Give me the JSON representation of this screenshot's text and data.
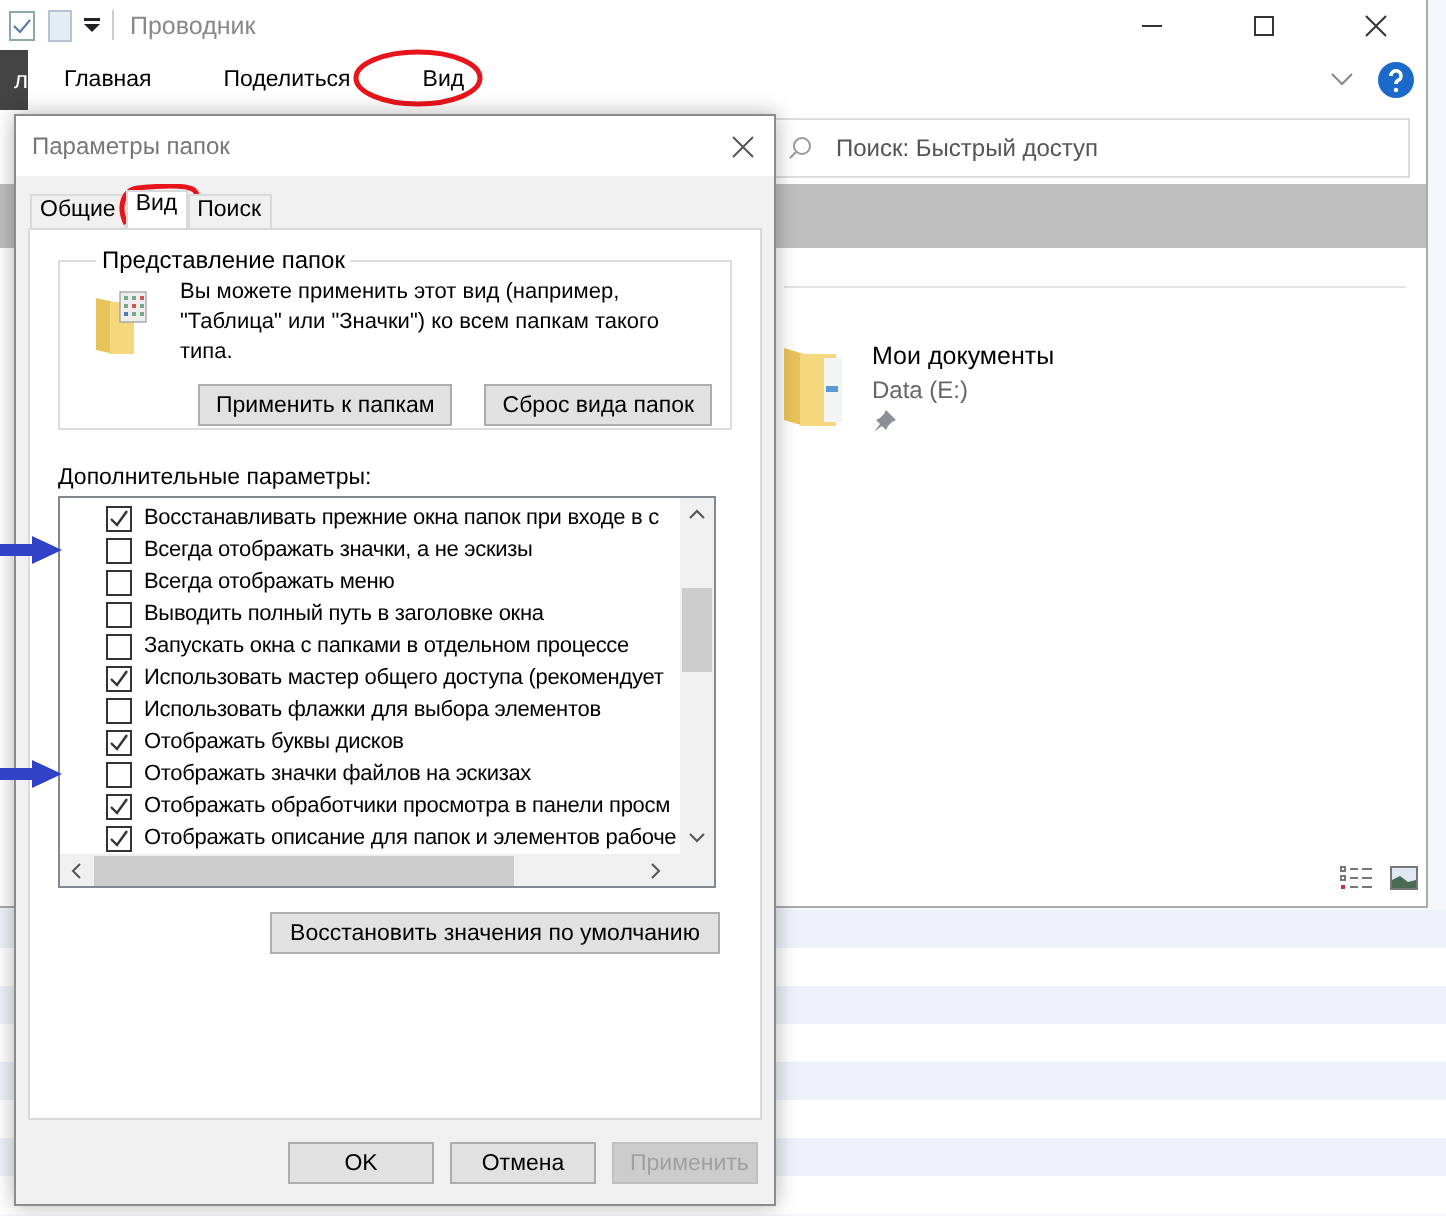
{
  "explorer": {
    "title": "Проводник",
    "file_tab": "л",
    "ribbon_tabs": [
      {
        "label": "Главная",
        "annotated": false
      },
      {
        "label": "Поделиться",
        "annotated": false
      },
      {
        "label": "Вид",
        "annotated": true
      }
    ],
    "search": {
      "placeholder": "Поиск: Быстрый доступ"
    },
    "items": [
      {
        "name": "Мои документы",
        "location": "Data (E:)",
        "pinned": true
      }
    ]
  },
  "dialog": {
    "title": "Параметры папок",
    "tabs": [
      {
        "label": "Общие",
        "selected": false
      },
      {
        "label": "Вид",
        "selected": true
      },
      {
        "label": "Поиск",
        "selected": false
      }
    ],
    "folder_views": {
      "title": "Представление папок",
      "text": "Вы можете применить этот вид (например, \"Таблица\" или \"Значки\") ко всем папкам такого типа.",
      "buttons": [
        "Применить к папкам",
        "Сброс вида папок"
      ]
    },
    "advanced_label": "Дополнительные параметры:",
    "options": [
      {
        "label": "Восстанавливать прежние окна папок при входе в с",
        "checked": true,
        "marked": false
      },
      {
        "label": "Всегда отображать значки, а не эскизы",
        "checked": false,
        "marked": true
      },
      {
        "label": "Всегда отображать меню",
        "checked": false,
        "marked": false
      },
      {
        "label": "Выводить полный путь в заголовке окна",
        "checked": false,
        "marked": false
      },
      {
        "label": "Запускать окна с папками в отдельном процессе",
        "checked": false,
        "marked": false
      },
      {
        "label": "Использовать мастер общего доступа (рекомендует",
        "checked": true,
        "marked": false
      },
      {
        "label": "Использовать флажки для выбора элементов",
        "checked": false,
        "marked": false
      },
      {
        "label": "Отображать буквы дисков",
        "checked": true,
        "marked": false
      },
      {
        "label": "Отображать значки файлов на эскизах",
        "checked": false,
        "marked": true
      },
      {
        "label": "Отображать обработчики просмотра в панели просм",
        "checked": true,
        "marked": false
      },
      {
        "label": "Отображать описание для папок и элементов рабоче",
        "checked": true,
        "marked": false
      }
    ],
    "restore_button": "Восстановить значения по умолчанию",
    "buttons": [
      {
        "label": "OK",
        "disabled": false
      },
      {
        "label": "Отмена",
        "disabled": false
      },
      {
        "label": "Применить",
        "disabled": true
      }
    ]
  }
}
